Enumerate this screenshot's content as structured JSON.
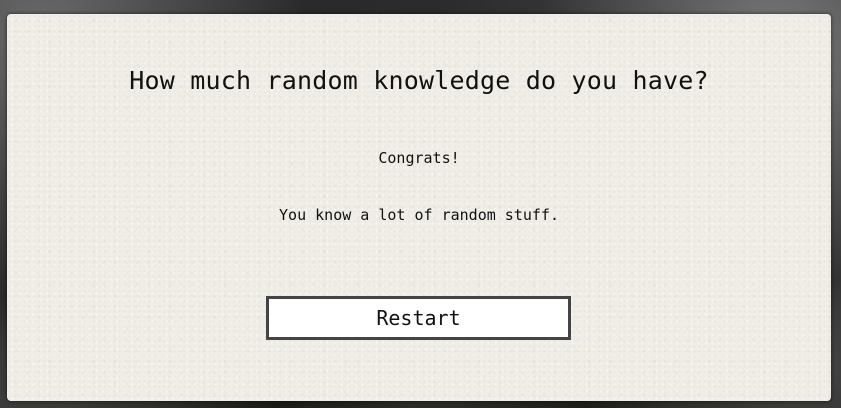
{
  "quiz": {
    "title": "How much random knowledge do you have?",
    "result_heading": "Congrats!",
    "result_message": "You know a lot of random stuff.",
    "restart_label": "Restart"
  }
}
